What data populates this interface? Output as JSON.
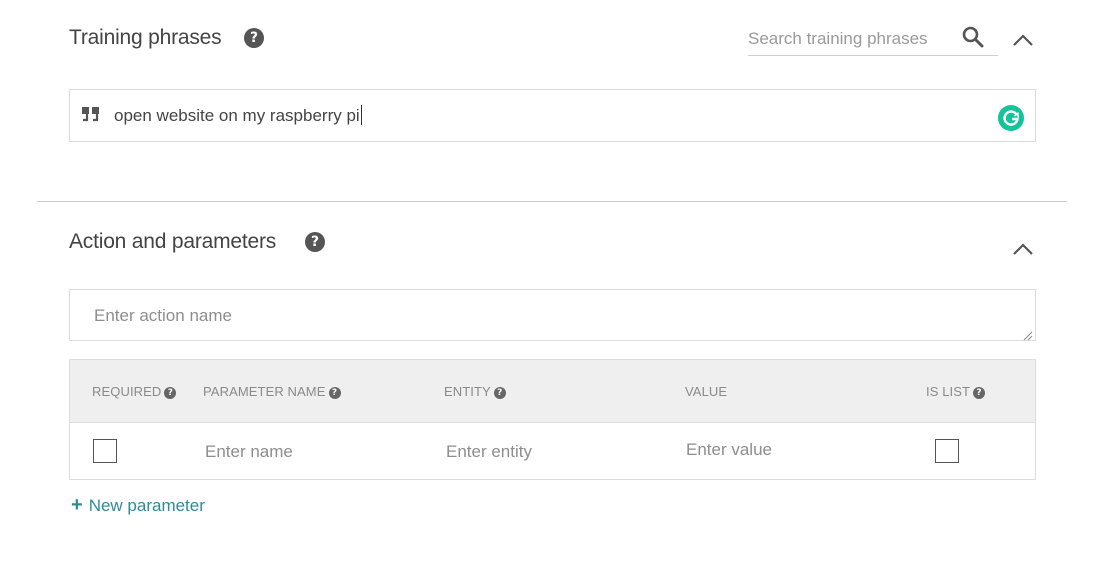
{
  "training": {
    "title": "Training phrases",
    "help_icon": "question-circle-icon",
    "search_placeholder": "Search training phrases",
    "search_icon": "search-icon",
    "collapse_icon": "chevron-up-icon",
    "phrase_icon": "quote-icon",
    "phrase_text": "open website on my raspberry pi",
    "grammarly_icon": "grammarly-icon",
    "grammarly_color": "#15c39a"
  },
  "action": {
    "title": "Action and parameters",
    "help_icon": "question-circle-icon",
    "collapse_icon": "chevron-up-icon",
    "action_placeholder": "Enter action name",
    "table": {
      "headers": {
        "required": "REQUIRED",
        "parameter_name": "PARAMETER NAME",
        "entity": "ENTITY",
        "value": "VALUE",
        "is_list": "IS LIST"
      },
      "row": {
        "required_checked": false,
        "name_placeholder": "Enter name",
        "entity_placeholder": "Enter entity",
        "value_placeholder": "Enter value",
        "is_list_checked": false
      }
    },
    "new_parameter_label": "New parameter",
    "accent_color": "#2e8c97"
  }
}
